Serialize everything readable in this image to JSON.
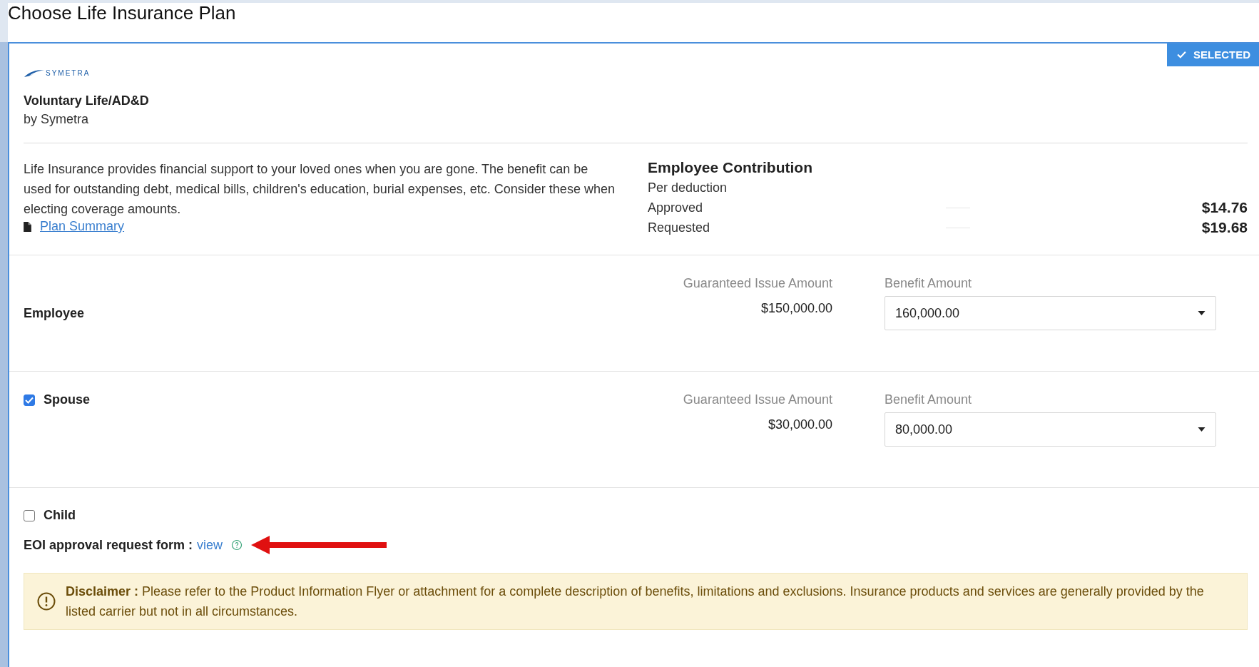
{
  "page_title": "Choose Life Insurance Plan",
  "plan": {
    "selected": true,
    "badge": "SELECTED",
    "logo_text": "SYMETRA",
    "name": "Voluntary Life/AD&D",
    "carrier": "by Symetra",
    "description": "Life Insurance provides financial support to your loved ones when you are gone. The benefit can be used for outstanding debt, medical bills, children's education, burial expenses, etc. Consider these when electing coverage amounts.",
    "summary_link": "Plan Summary",
    "contribution": {
      "title": "Employee Contribution",
      "subtitle": "Per deduction",
      "lines": [
        {
          "label": "Approved",
          "amount": "$14.76"
        },
        {
          "label": "Requested",
          "amount": "$19.68"
        }
      ]
    }
  },
  "coverages": [
    {
      "kind": "fixed",
      "label": "Employee",
      "guaranteed_label": "Guaranteed Issue Amount",
      "guaranteed_amount": "$150,000.00",
      "benefit_label": "Benefit Amount",
      "benefit_value": "160,000.00"
    },
    {
      "kind": "optional",
      "label": "Spouse",
      "checked": true,
      "guaranteed_label": "Guaranteed Issue Amount",
      "guaranteed_amount": "$30,000.00",
      "benefit_label": "Benefit Amount",
      "benefit_value": "80,000.00"
    },
    {
      "kind": "optional",
      "label": "Child",
      "checked": false
    }
  ],
  "eoi": {
    "label": "EOI approval request form :",
    "link": "view"
  },
  "disclaimer": {
    "text": "**Disclaimer :** Please refer to the Product Information Flyer or attachment for a complete description of benefits, limitations and exclusions. Insurance products and services are generally provided by the listed carrier but not in all circumstances."
  }
}
